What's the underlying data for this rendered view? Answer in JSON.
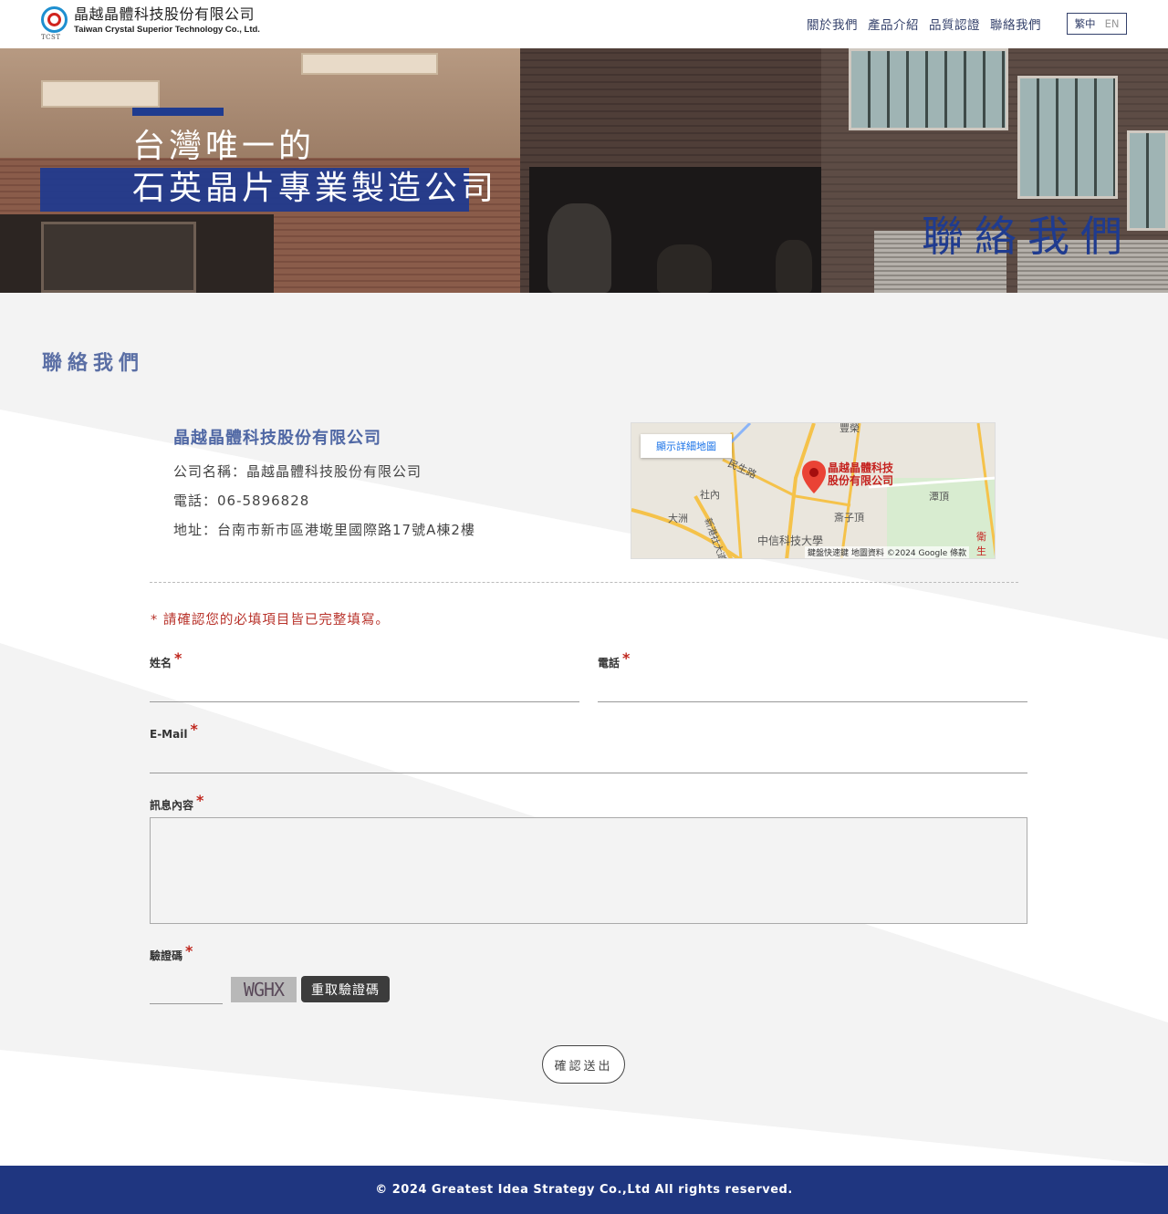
{
  "header": {
    "logo_cn": "晶越晶體科技股份有限公司",
    "logo_en": "Taiwan Crystal Superior Technology Co., Ltd.",
    "logo_mark_text": "TCST",
    "nav": [
      "關於我們",
      "產品介紹",
      "品質認證",
      "聯絡我們"
    ],
    "lang_zh": "繁中",
    "lang_en": "EN"
  },
  "banner": {
    "line1": "台灣唯一的",
    "line2": "石英晶片專業製造公司",
    "page_label": "聯絡我們"
  },
  "section_title": "聯絡我們",
  "company": {
    "name": "晶越晶體科技股份有限公司",
    "name_line": "公司名稱：晶越晶體科技股份有限公司",
    "phone_line": "電話：06-5896828",
    "address_line": "地址：台南市新市區港墘里國際路17號A棟2樓"
  },
  "map": {
    "view_larger": "顯示詳細地圖",
    "poi_line1": "晶越晶體科技",
    "poi_line2": "股份有限公司",
    "labels": [
      "豐榮",
      "民生路",
      "社內",
      "大洲",
      "新港社大道",
      "潭頂",
      "斎子頂",
      "中信科技大學",
      "衛生"
    ],
    "footer": "鍵盤快速鍵   地圖資料 ©2024 Google   條款"
  },
  "form": {
    "required_note": "* 請確認您的必填項目皆已完整填寫。",
    "name_label": "姓名",
    "phone_label": "電話",
    "email_label": "E-Mail",
    "message_label": "訊息內容",
    "captcha_label": "驗證碼",
    "captcha_code": "WGHX",
    "refresh_captcha": "重取驗證碼",
    "submit": "確認送出",
    "required_mark": "*"
  },
  "footer": {
    "copyright": "© 2024 Greatest Idea Strategy Co.,Ltd All rights reserved."
  },
  "colors": {
    "brand_blue": "#1f3b8f",
    "footer_blue": "#1f3680",
    "required_red": "#c0271e"
  }
}
